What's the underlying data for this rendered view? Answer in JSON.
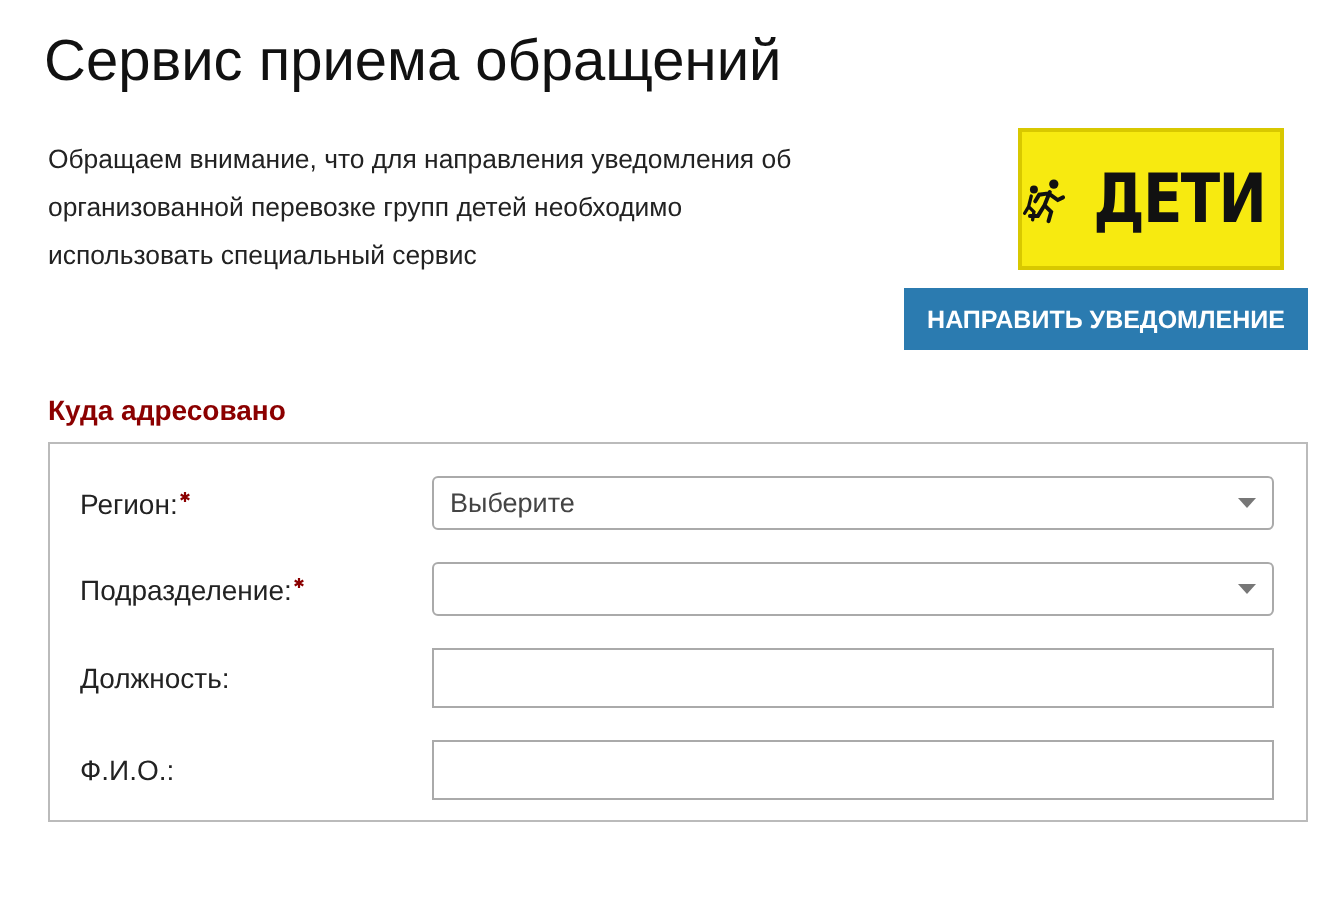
{
  "title": "Сервис приема обращений",
  "notice": {
    "text": "Обращаем внимание, что для направления уведомления об организованной перевозке групп детей необходимо использовать специальный сервис",
    "sign_text": "ДЕТИ",
    "button": "НАПРАВИТЬ УВЕДОМЛЕНИЕ"
  },
  "section": {
    "title": "Куда адресовано",
    "fields": [
      {
        "label": "Регион:",
        "required": true,
        "kind": "select",
        "value": "Выберите"
      },
      {
        "label": "Подразделение:",
        "required": true,
        "kind": "select"
      },
      {
        "label": "Должность:",
        "required": false,
        "kind": "text"
      },
      {
        "label": "Ф.И.О.:",
        "required": false,
        "kind": "text"
      }
    ]
  }
}
